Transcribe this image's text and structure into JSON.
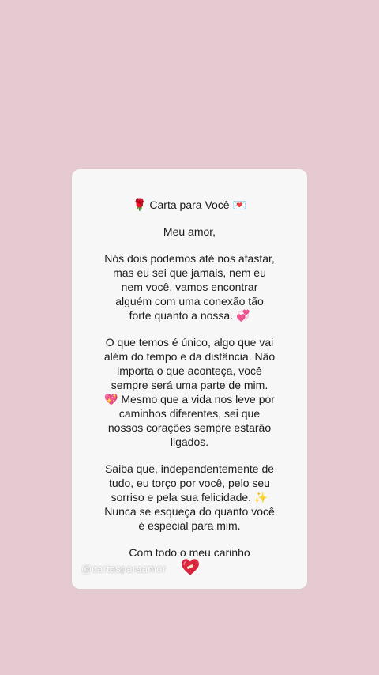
{
  "letter": {
    "title": "Carta para Você",
    "title_prefix_emoji": "🌹",
    "title_suffix_emoji": "💌",
    "greeting": "Meu amor,",
    "paragraph1": [
      "Nós dois podemos até nos afastar,",
      "mas eu sei que jamais, nem eu",
      "nem você, vamos encontrar",
      "alguém com uma conexão tão",
      "forte quanto a nossa. 💞"
    ],
    "paragraph2": [
      "O que temos é único, algo que vai",
      "além do tempo e da distância. Não",
      "importa o que aconteça, você",
      "sempre será uma parte de mim.",
      "💖 Mesmo que a vida nos leve por",
      "caminhos diferentes, sei que",
      "nossos corações sempre estarão",
      "ligados."
    ],
    "paragraph3": [
      "Saiba que, independentemente de",
      "tudo, eu torço por você, pelo seu",
      "sorriso e pela sua felicidade. ✨",
      "Nunca se esqueça do quanto você",
      "é especial para mim."
    ],
    "closing": "Com todo o meu carinho",
    "closing_emoji": "❤️‍🩹",
    "watermark": "@cartasparaamor"
  },
  "colors": {
    "background": "#e5cad1",
    "card": "#f8f7f8",
    "text": "#1b1b1b",
    "heart": "#d7263d"
  }
}
